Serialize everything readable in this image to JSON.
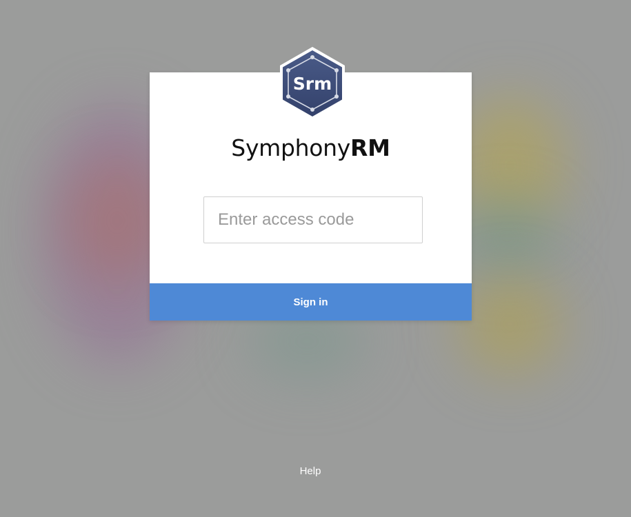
{
  "app": {
    "logo_text": "Srm",
    "brand_light": "Symphony",
    "brand_bold": "RM"
  },
  "login": {
    "access_code_value": "",
    "access_code_placeholder": "Enter access code",
    "sign_in_label": "Sign in"
  },
  "footer": {
    "help_label": "Help"
  },
  "colors": {
    "accent": "#4e89d6",
    "logo_navy": "#3c4c7a",
    "background": "#9b9c9b"
  }
}
